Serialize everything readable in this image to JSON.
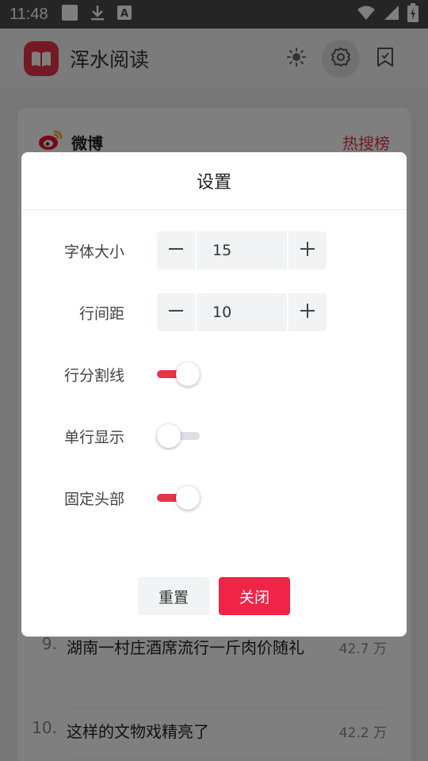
{
  "status_bar": {
    "time": "11:48",
    "icons": [
      "notification-square-icon",
      "download-icon",
      "text-a-icon",
      "wifi-icon",
      "cell-signal-icon",
      "battery-charging-icon"
    ]
  },
  "app_bar": {
    "title": "浑水阅读",
    "icons": [
      "brightness-icon",
      "settings-icon",
      "bookmark-icon"
    ]
  },
  "card": {
    "source": "微博",
    "board_link": "热搜榜",
    "items": [
      {
        "index": "9.",
        "title": "湖南一村庄酒席流行一斤肉价随礼",
        "heat": "42.7 万"
      },
      {
        "index": "10.",
        "title": "这样的文物戏精亮了",
        "heat": "42.2 万"
      }
    ]
  },
  "dialog": {
    "title": "设置",
    "font_size": {
      "label": "字体大小",
      "value": "15"
    },
    "line_spacing": {
      "label": "行间距",
      "value": "10"
    },
    "line_divider": {
      "label": "行分割线",
      "on": true
    },
    "single_line": {
      "label": "单行显示",
      "on": false
    },
    "fixed_header": {
      "label": "固定头部",
      "on": true
    },
    "reset_label": "重置",
    "close_label": "关闭"
  },
  "colors": {
    "accent": "#e8344a",
    "close_button": "#ef2447",
    "status_bar": "#4a4a4a"
  }
}
